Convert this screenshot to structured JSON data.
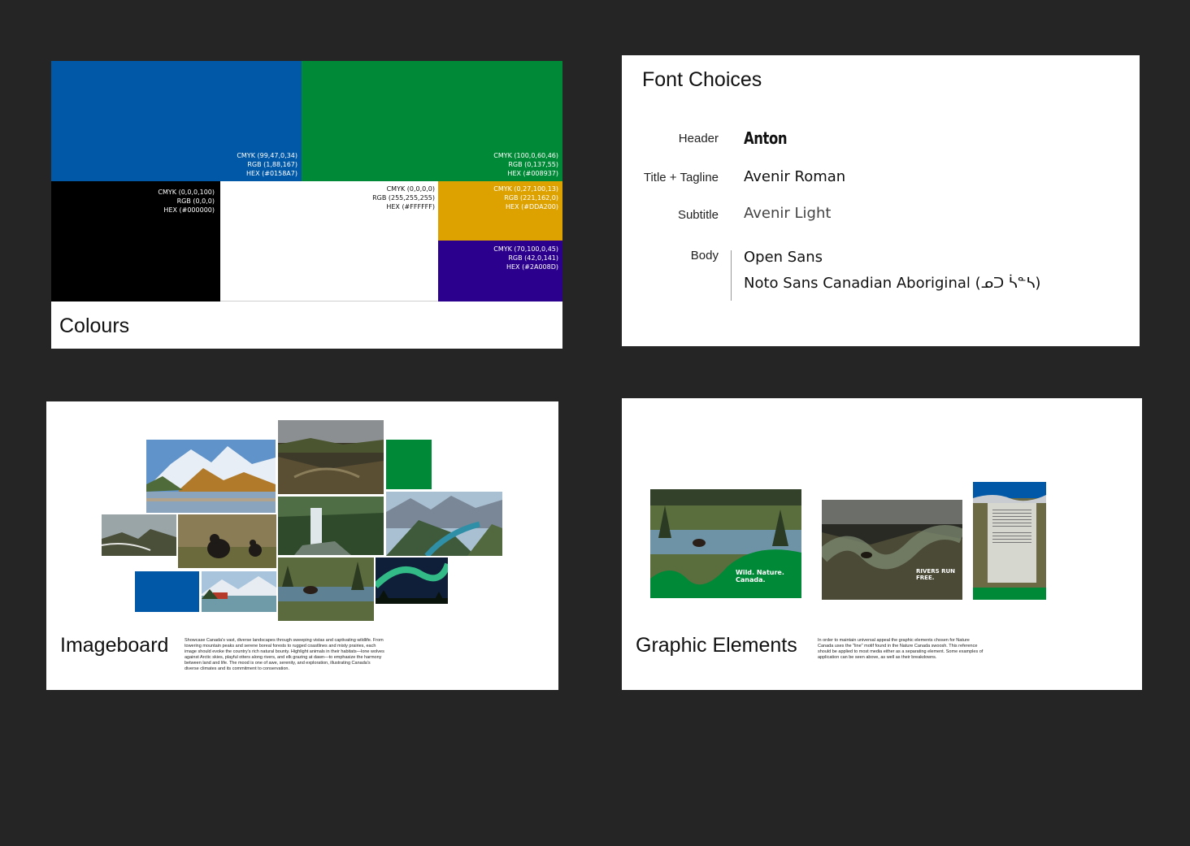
{
  "colours": {
    "title": "Colours",
    "swatches": [
      {
        "name": "blue",
        "hex": "#0158A7",
        "text_color": "#ffffff",
        "lines": [
          "CMYK (99,47,0,34)",
          "RGB (1,88,167)",
          "HEX (#0158A7)"
        ]
      },
      {
        "name": "green",
        "hex": "#008937",
        "text_color": "#ffffff",
        "lines": [
          "CMYK (100,0,60,46)",
          "RGB (0,137,55)",
          "HEX (#008937)"
        ]
      },
      {
        "name": "black",
        "hex": "#000000",
        "text_color": "#ffffff",
        "lines": [
          "CMYK (0,0,0,100)",
          "RGB (0,0,0)",
          "HEX (#000000)"
        ]
      },
      {
        "name": "white",
        "hex": "#FFFFFF",
        "text_color": "#111111",
        "lines": [
          "CMYK (0,0,0,0)",
          "RGB (255,255,255)",
          "HEX (#FFFFFF)"
        ]
      },
      {
        "name": "gold",
        "hex": "#DDA200",
        "text_color": "#ffffff",
        "lines": [
          "CMYK (0,27,100,13)",
          "RGB (221,162,0)",
          "HEX (#DDA200)"
        ]
      },
      {
        "name": "purple",
        "hex": "#2A008D",
        "text_color": "#ffffff",
        "lines": [
          "CMYK (70,100,0,45)",
          "RGB (42,0,141)",
          "HEX (#2A008D)"
        ]
      }
    ]
  },
  "fonts": {
    "title": "Font Choices",
    "rows": [
      {
        "role": "Header",
        "faces": [
          "Anton"
        ]
      },
      {
        "role": "Title + Tagline",
        "faces": [
          "Avenir Roman"
        ]
      },
      {
        "role": "Subtitle",
        "faces": [
          "Avenir Light"
        ]
      },
      {
        "role": "Body",
        "faces": [
          "Open Sans",
          "Noto Sans Canadian Aboriginal (ᓄᑐ ᓵᓐᓴ)"
        ]
      }
    ]
  },
  "imageboard": {
    "title": "Imageboard",
    "description": "Showcase Canada's vast, diverse landscapes through sweeping vistas and captivating wildlife. From towering mountain peaks and serene boreal forests to rugged coastlines and misty prairies, each image should evoke the country's rich natural bounty. Highlight animals in their habitats—lone wolves against Arctic skies, playful otters along rivers, and elk grazing at dawn—to emphasize the harmony between land and life. The mood is one of awe, serenity, and exploration, illustrating Canada's diverse climates and its commitment to conservation.",
    "colors": {
      "blue": "#0158A7",
      "green": "#008937"
    }
  },
  "graphic": {
    "title": "Graphic Elements",
    "description": "In order to maintain universal appeal the graphic elements chosen for Nature Canada uses the \"line\" motif found in the Nature Canada swoosh. This reference should be applied to most media either as a separating element. Some examples of application can be seen above, as well as their breakdowns.",
    "example_1_tagline": "Wild. Nature. Canada.",
    "example_2_tagline": "RIVERS RUN FREE."
  }
}
